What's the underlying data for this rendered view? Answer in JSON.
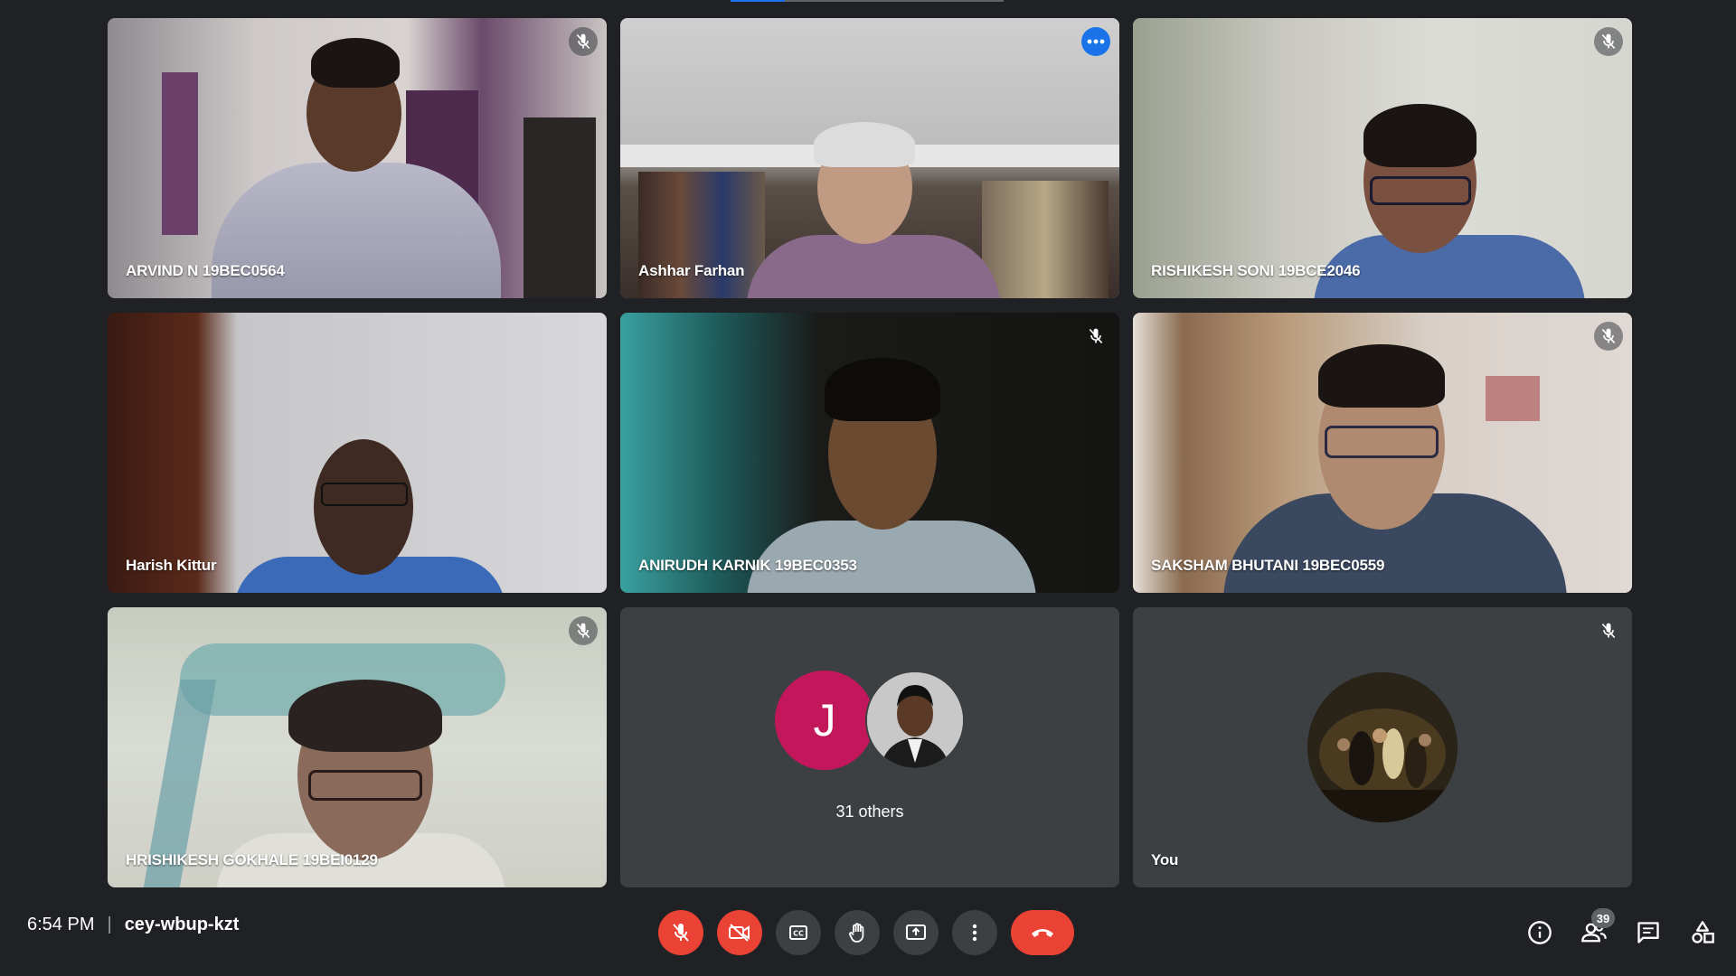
{
  "meeting": {
    "time": "6:54 PM",
    "separator": "|",
    "code": "cey-wbup-kzt"
  },
  "participants": [
    {
      "name": "ARVIND N 19BEC0564",
      "muted": true,
      "speaking": false
    },
    {
      "name": "Ashhar Farhan",
      "muted": false,
      "speaking": true
    },
    {
      "name": "RISHIKESH SONI 19BCE2046",
      "muted": true,
      "speaking": false
    },
    {
      "name": "Harish Kittur",
      "muted": false,
      "speaking": false
    },
    {
      "name": "ANIRUDH KARNIK 19BEC0353",
      "muted": true,
      "speaking": false
    },
    {
      "name": "SAKSHAM BHUTANI 19BEC0559",
      "muted": true,
      "speaking": false
    },
    {
      "name": "HRISHIKESH GOKHALE 19BEI0129",
      "muted": true,
      "speaking": false
    }
  ],
  "others": {
    "initial": "J",
    "initial_color": "#c2185b",
    "label": "31 others"
  },
  "self": {
    "label": "You",
    "muted": true
  },
  "participant_count": "39",
  "icons": {
    "mic_off": "mic-off-icon",
    "camera_off": "camera-off-icon",
    "captions": "captions-icon",
    "raise_hand": "raise-hand-icon",
    "present": "present-screen-icon",
    "more": "more-options-icon",
    "end_call": "end-call-icon",
    "info": "info-icon",
    "people": "people-icon",
    "chat": "chat-icon",
    "activities": "activities-icon"
  },
  "colors": {
    "background": "#202124",
    "tile": "#3c4043",
    "danger": "#ea4335",
    "speaking_outline": "#8ab4f8",
    "accent": "#1a73e8"
  }
}
